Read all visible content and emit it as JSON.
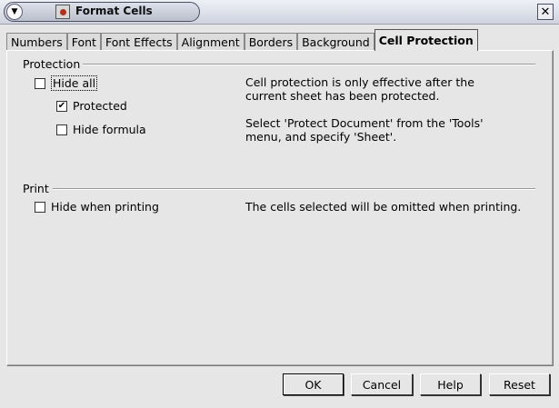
{
  "window": {
    "title": "Format Cells",
    "menu_icon": "chevron-down-icon",
    "app_icon": "document-icon",
    "close_icon": "close-icon"
  },
  "tabs": [
    {
      "label": "Numbers",
      "active": false
    },
    {
      "label": "Font",
      "active": false
    },
    {
      "label": "Font Effects",
      "active": false
    },
    {
      "label": "Alignment",
      "active": false
    },
    {
      "label": "Borders",
      "active": false
    },
    {
      "label": "Background",
      "active": false
    },
    {
      "label": "Cell Protection",
      "active": true
    }
  ],
  "protection": {
    "title": "Protection",
    "hide_all": {
      "label": "Hide all",
      "checked": false
    },
    "protected": {
      "label": "Protected",
      "checked": true
    },
    "hide_formula": {
      "label": "Hide formula",
      "checked": false
    },
    "info1": "Cell protection is only effective after the current sheet has been protected.",
    "info2": "Select 'Protect Document' from the 'Tools' menu, and specify 'Sheet'."
  },
  "print": {
    "title": "Print",
    "hide_when_printing": {
      "label": "Hide when printing",
      "checked": false
    },
    "info": "The cells selected will be omitted when printing."
  },
  "buttons": {
    "ok": "OK",
    "cancel": "Cancel",
    "help": "Help",
    "reset": "Reset"
  }
}
